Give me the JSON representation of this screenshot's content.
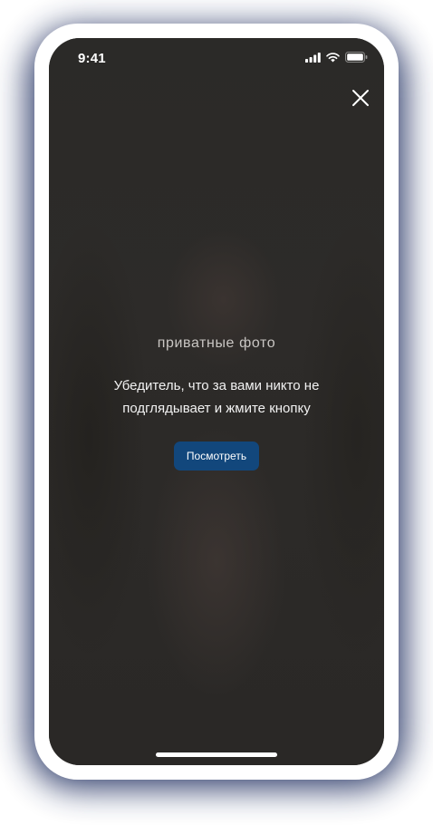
{
  "status_bar": {
    "time": "9:41",
    "icons": [
      "cellular-signal-icon",
      "wifi-icon",
      "battery-icon"
    ]
  },
  "close_icon": "close-icon",
  "private_label": "приватные фото",
  "message": "Убедитель, что за вами никто не подглядывает и жмите кнопку",
  "view_button_label": "Посмотреть",
  "colors": {
    "background": "#2b2a28",
    "accent_button": "#12477c",
    "text_primary": "#f2f2f2",
    "text_secondary": "#c9c6c3",
    "frame": "#ffffff",
    "shadow": "#1d2c5e"
  }
}
